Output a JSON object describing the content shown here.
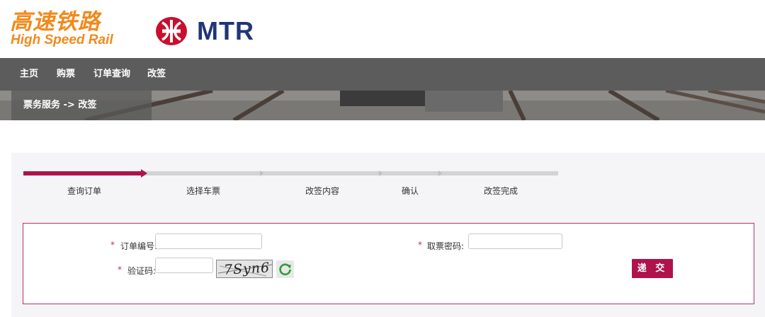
{
  "header": {
    "hsr_logo_cn": "高速铁路",
    "hsr_logo_en": "High Speed Rail",
    "mtr_logo_text": "MTR",
    "colors": {
      "hsr_orange": "#f08a1c",
      "mtr_navy": "#1f3677",
      "mtr_red": "#c8102e"
    }
  },
  "nav": {
    "items": [
      {
        "label": "主页"
      },
      {
        "label": "购票"
      },
      {
        "label": "订单查询"
      },
      {
        "label": "改签"
      }
    ]
  },
  "breadcrumb": {
    "text": "票务服务 -> 改签"
  },
  "steps": {
    "current_index": 0,
    "items": [
      {
        "label": "查询订单"
      },
      {
        "label": "选择车票"
      },
      {
        "label": "改签内容"
      },
      {
        "label": "确认"
      },
      {
        "label": "改签完成"
      }
    ]
  },
  "form": {
    "required_mark": "*",
    "order_no_label": "订单编号:",
    "order_no_value": "",
    "pickup_pwd_label": "取票密码:",
    "pickup_pwd_value": "",
    "captcha_label": "验证码:",
    "captcha_value": "",
    "captcha_image_text": "7Syn6",
    "refresh_icon": "refresh-icon",
    "submit_label": "递 交"
  },
  "accent_color": "#b0124b"
}
